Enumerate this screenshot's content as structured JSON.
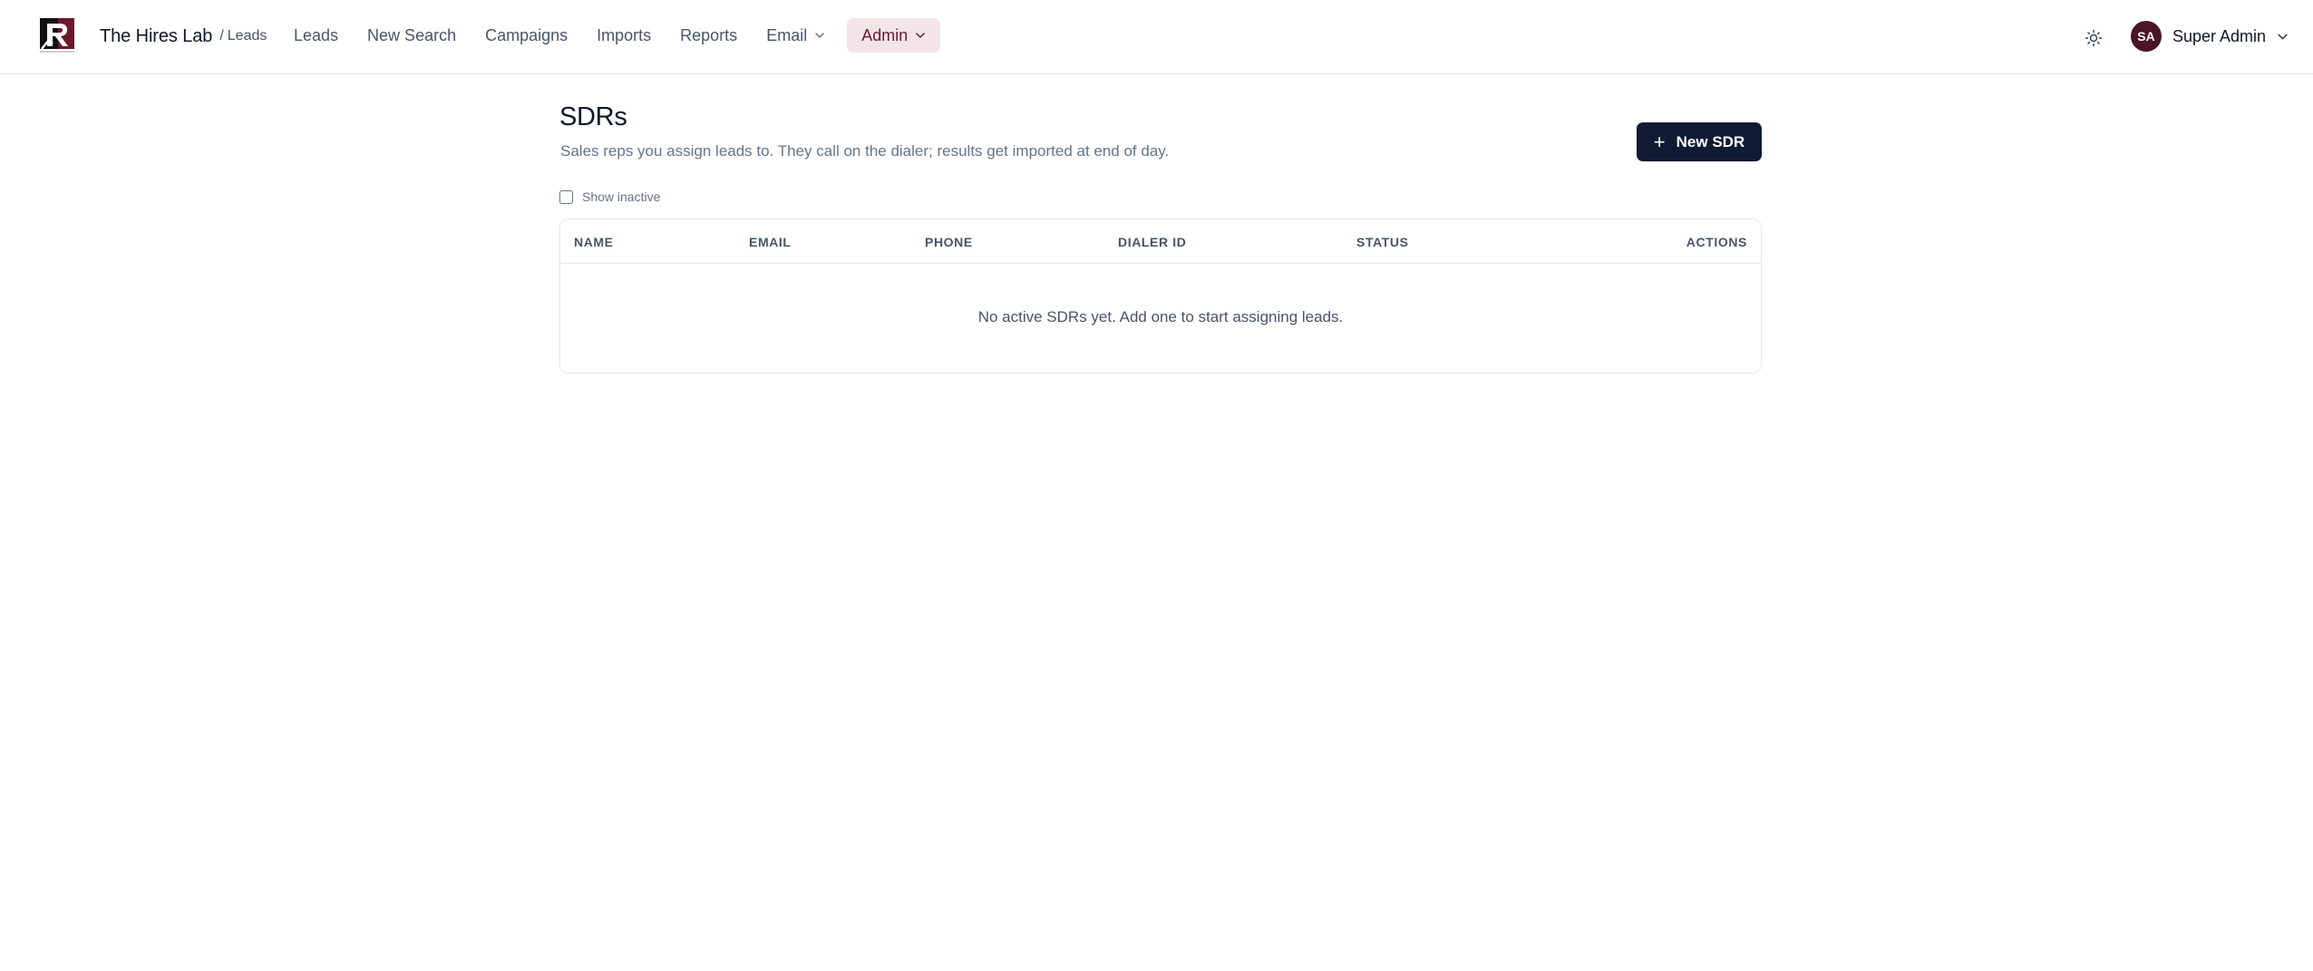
{
  "brand": {
    "name": "The Hires Lab",
    "separator": "/",
    "section": "Leads"
  },
  "nav": {
    "items": [
      {
        "label": "Leads"
      },
      {
        "label": "New Search"
      },
      {
        "label": "Campaigns"
      },
      {
        "label": "Imports"
      },
      {
        "label": "Reports"
      },
      {
        "label": "Email"
      },
      {
        "label": "Admin"
      }
    ],
    "active": "Admin"
  },
  "user": {
    "initials": "SA",
    "name": "Super Admin"
  },
  "page": {
    "title": "SDRs",
    "subtitle": "Sales reps you assign leads to. They call on the dialer; results get imported at end of day.",
    "new_button_label": "New SDR",
    "show_inactive_label": "Show inactive",
    "show_inactive_checked": false
  },
  "table": {
    "columns": [
      "NAME",
      "EMAIL",
      "PHONE",
      "DIALER ID",
      "STATUS",
      "ACTIONS"
    ],
    "rows": [],
    "empty_message": "No active SDRs yet. Add one to start assigning leads."
  },
  "colors": {
    "primary": "#0f1b33",
    "accent": "#6b1a2c",
    "accent_bg": "#f3e4e7",
    "avatar_bg": "#4a1524"
  },
  "icons": {
    "theme_toggle": "sun-icon",
    "dropdown": "chevron-down-icon",
    "add": "plus-icon"
  }
}
